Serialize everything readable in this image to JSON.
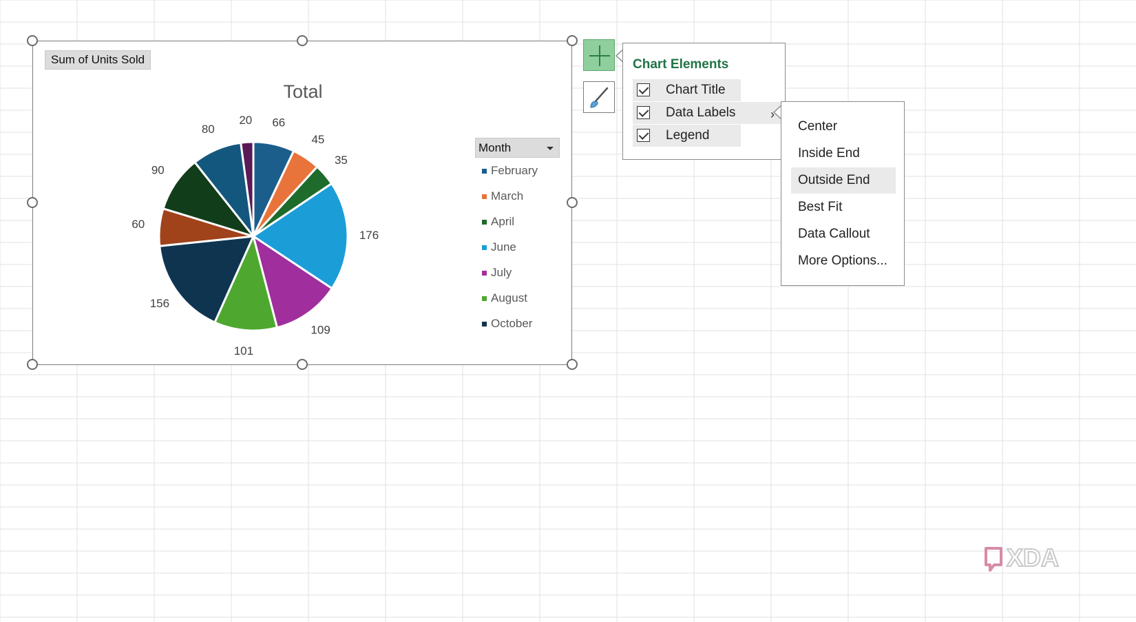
{
  "pivot_field_button": "Sum of Units Sold",
  "legend": {
    "filter_label": "Month",
    "items": [
      {
        "label": "February",
        "color": "#1b5e8c"
      },
      {
        "label": "March",
        "color": "#e8743b"
      },
      {
        "label": "April",
        "color": "#1e6b2c"
      },
      {
        "label": "June",
        "color": "#1b9ed8"
      },
      {
        "label": "July",
        "color": "#a02e9c"
      },
      {
        "label": "August",
        "color": "#4ea82f"
      },
      {
        "label": "October",
        "color": "#0f3450"
      }
    ]
  },
  "chart_data": {
    "type": "pie",
    "title": "Total",
    "values": [
      66,
      45,
      35,
      176,
      109,
      101,
      156,
      60,
      90,
      80,
      20
    ],
    "data_labels": [
      "66",
      "45",
      "35",
      "176",
      "109",
      "101",
      "156",
      "60",
      "90",
      "80",
      "20"
    ],
    "colors": [
      "#1b5e8c",
      "#e8743b",
      "#1e6b2c",
      "#1b9ed8",
      "#a02e9c",
      "#4ea82f",
      "#0f3450",
      "#a0421a",
      "#123d1a",
      "#14577e",
      "#5a1a56"
    ],
    "label_position": "outside end"
  },
  "chart_elements_panel": {
    "title": "Chart Elements",
    "items": [
      {
        "label": "Chart Title",
        "checked": true
      },
      {
        "label": "Data Labels",
        "checked": true
      },
      {
        "label": "Legend",
        "checked": true
      }
    ]
  },
  "data_labels_submenu": {
    "items": [
      "Center",
      "Inside End",
      "Outside End",
      "Best Fit",
      "Data Callout",
      "More Options..."
    ],
    "selected": "Outside End"
  },
  "watermark": "XDA"
}
